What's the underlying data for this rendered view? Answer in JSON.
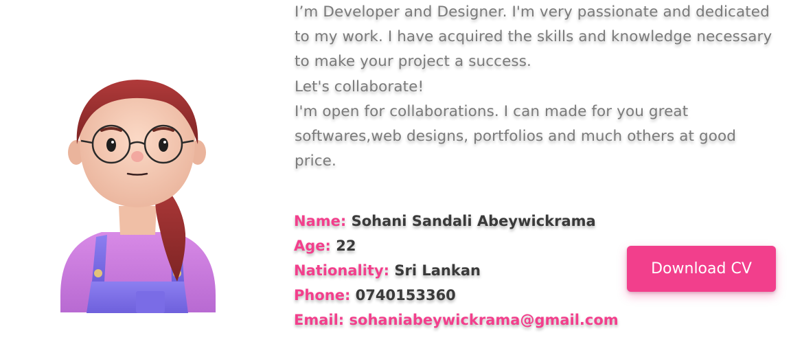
{
  "about": {
    "bio_paragraph_1": "I’m Developer and Designer. I'm very passionate and dedicated to my work. I have acquired the skills and knowledge necessary to make your project a success.",
    "bio_paragraph_2": "Let's collaborate!",
    "bio_paragraph_3": "I'm open for collaborations. I can made for you great softwares,web designs, portfolios and much others at good price."
  },
  "info": {
    "name_label": "Name:",
    "name_value": "Sohani Sandali Abeywickrama",
    "age_label": "Age:",
    "age_value": "22",
    "nationality_label": "Nationality:",
    "nationality_value": "Sri Lankan",
    "phone_label": "Phone:",
    "phone_value": "0740153360",
    "email_label": "Email:",
    "email_value": "sohaniabeywickrama@gmail.com"
  },
  "actions": {
    "download_cv_label": "Download CV"
  },
  "colors": {
    "accent": "#f23f8c",
    "body_text": "#7a7a7a",
    "value_text": "#3a3a3a"
  },
  "icons": {
    "avatar": "avatar-illustration"
  }
}
